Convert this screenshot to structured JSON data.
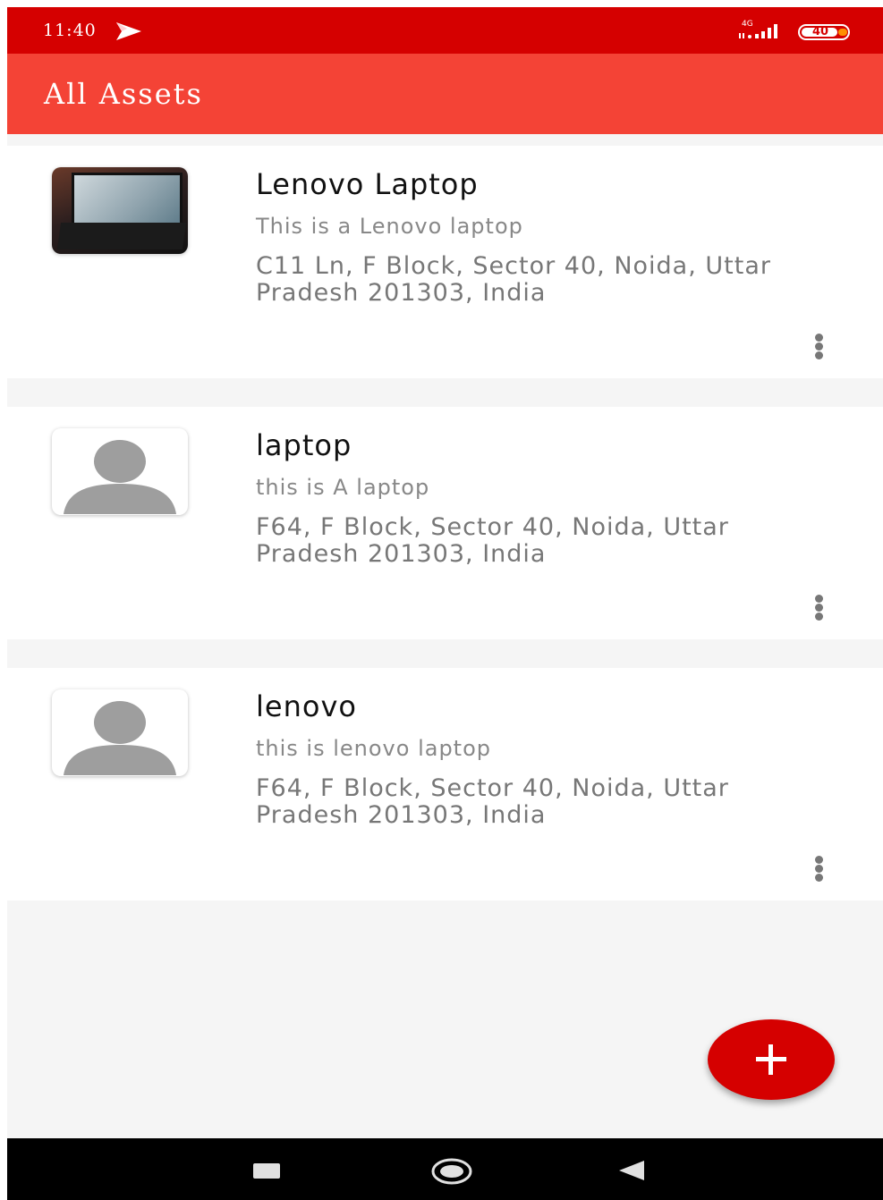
{
  "status_bar": {
    "time": "11:40",
    "network": "4G",
    "battery": "40",
    "background": "#d50000"
  },
  "app_bar": {
    "title": "All Assets",
    "background": "#f44336"
  },
  "assets": [
    {
      "title": "Lenovo Laptop",
      "description": "This is a Lenovo laptop",
      "address": "C11 Ln, F Block, Sector 40, Noida, Uttar Pradesh 201303, India",
      "thumbnail": "laptop-photo"
    },
    {
      "title": "laptop",
      "description": "this is A laptop",
      "address": "F64, F Block, Sector 40, Noida, Uttar Pradesh 201303, India",
      "thumbnail": "avatar-placeholder-icon"
    },
    {
      "title": "lenovo",
      "description": "this is lenovo laptop",
      "address": "F64, F Block, Sector 40, Noida, Uttar Pradesh 201303, India",
      "thumbnail": "avatar-placeholder-icon"
    }
  ],
  "fab": {
    "icon": "plus-icon",
    "color": "#d50000"
  },
  "nav_bar": {
    "icons": [
      "recents-icon",
      "home-icon",
      "back-icon"
    ]
  }
}
